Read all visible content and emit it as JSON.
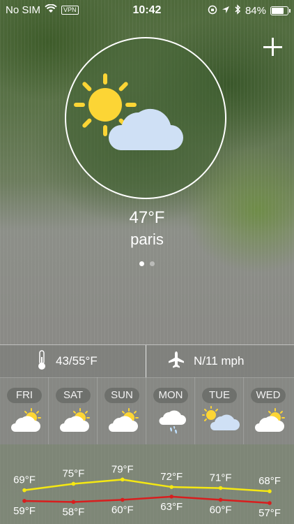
{
  "status_bar": {
    "carrier": "No SIM",
    "vpn": "VPN",
    "time": "10:42",
    "battery": "84%",
    "battery_level": 0.84
  },
  "current": {
    "temperature": "47°F",
    "city": "paris",
    "condition_icon": "partly-cloudy-icon",
    "page_count": 2,
    "active_page": 0
  },
  "details": {
    "temp_range": "43/55°F",
    "wind": "N/11 mph",
    "temp_icon": "thermometer-icon",
    "wind_icon": "airplane-icon"
  },
  "forecast": [
    {
      "day": "FRI",
      "icon": "partly-cloudy-icon"
    },
    {
      "day": "SAT",
      "icon": "partly-cloudy-icon"
    },
    {
      "day": "SUN",
      "icon": "partly-cloudy-icon"
    },
    {
      "day": "MON",
      "icon": "rain-icon"
    },
    {
      "day": "TUE",
      "icon": "sun-cloud-icon"
    },
    {
      "day": "WED",
      "icon": "partly-cloudy-icon"
    }
  ],
  "chart_data": {
    "type": "line",
    "categories": [
      "FRI",
      "SAT",
      "SUN",
      "MON",
      "TUE",
      "WED"
    ],
    "series": [
      {
        "values": [
          69,
          75,
          79,
          72,
          71,
          68
        ],
        "labels": [
          "69°F",
          "75°F",
          "79°F",
          "72°F",
          "71°F",
          "68°F"
        ],
        "color": "#f5e812"
      },
      {
        "values": [
          59,
          58,
          60,
          63,
          60,
          57
        ],
        "labels": [
          "59°F",
          "58°F",
          "60°F",
          "63°F",
          "60°F",
          "57°F"
        ],
        "color": "#d81e1e"
      }
    ]
  },
  "colors": {
    "sun": "#fcd535",
    "cloud": "#cfe0f5",
    "rain_drop": "#bfe0ff"
  }
}
